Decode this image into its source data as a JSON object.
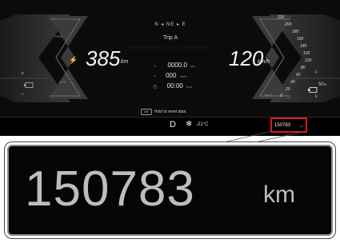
{
  "compass": {
    "text": "N ◂ NE ▸ E"
  },
  "trip": {
    "title": "Trip A",
    "rows": [
      {
        "icon": "⇔",
        "value": "0000.0",
        "unit": "km"
      },
      {
        "icon": "◔",
        "value": "000",
        "unit": "km/h"
      },
      {
        "icon": "◷",
        "value": "00:00",
        "unit": "h:m"
      }
    ]
  },
  "range": {
    "value": "385",
    "unit": "km",
    "icon": "⚡"
  },
  "speed": {
    "value": "120",
    "unit": "km/h"
  },
  "left_gauge": {
    "top_label": "PWR",
    "bottom_label": "CHG",
    "plus": "+",
    "minus": "–",
    "battery_icon": "battery-icon"
  },
  "right_gauge": {
    "ticks": [
      "220",
      "200",
      "180",
      "160",
      "140",
      "120",
      "100",
      "80",
      "60",
      "40",
      "20",
      "0"
    ],
    "full_label": "F",
    "empty_label": "E",
    "battery_percent": "50",
    "percent_sign": "%",
    "save_label": "SAVE"
  },
  "ok_hint": {
    "badge": "OK",
    "text": "Hold to reset data"
  },
  "status": {
    "gear": "D",
    "snow_icon": "❄",
    "temperature": "-21°C"
  },
  "odometer": {
    "value": "150783",
    "unit": "km"
  }
}
